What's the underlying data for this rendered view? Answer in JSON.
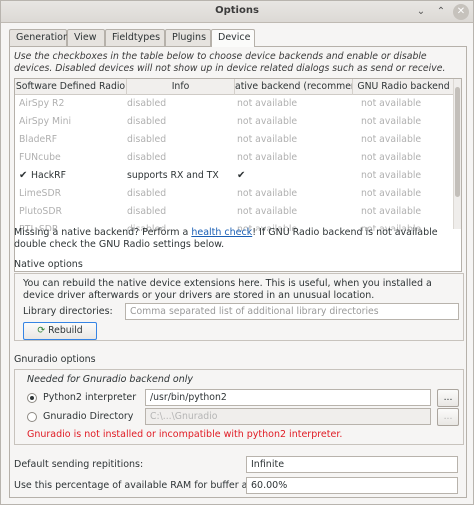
{
  "window": {
    "title": "Options",
    "minimize_glyph": "⌄",
    "maximize_glyph": "⌃",
    "close_glyph": "✕"
  },
  "tabs": [
    {
      "label": "Generation"
    },
    {
      "label": "View"
    },
    {
      "label": "Fieldtypes"
    },
    {
      "label": "Plugins"
    },
    {
      "label": "Device",
      "active": true
    }
  ],
  "device": {
    "intro": "Use the checkboxes in the table below to choose device backends and enable or disable devices. Disabled devices will not show up in device related dialogs such as send or receive.",
    "table": {
      "headers": [
        "Software Defined Radio",
        "Info",
        "ative backend (recommende",
        "GNU Radio backend"
      ],
      "rows": [
        {
          "name": "AirSpy R2",
          "info": "disabled",
          "native": "not available",
          "gnuradio": "not available",
          "enabled": false
        },
        {
          "name": "AirSpy Mini",
          "info": "disabled",
          "native": "not available",
          "gnuradio": "not available",
          "enabled": false
        },
        {
          "name": "BladeRF",
          "info": "disabled",
          "native": "not available",
          "gnuradio": "not available",
          "enabled": false
        },
        {
          "name": "FUNcube",
          "info": "disabled",
          "native": "not available",
          "gnuradio": "not available",
          "enabled": false
        },
        {
          "name": "HackRF",
          "info": "supports RX and TX",
          "native": "✔",
          "gnuradio": "not available",
          "enabled": true,
          "check": "✔"
        },
        {
          "name": "LimeSDR",
          "info": "disabled",
          "native": "not available",
          "gnuradio": "not available",
          "enabled": false
        },
        {
          "name": "PlutoSDR",
          "info": "disabled",
          "native": "not available",
          "gnuradio": "not available",
          "enabled": false
        },
        {
          "name": "RTL-SDR",
          "info": "disabled",
          "native": "not available",
          "gnuradio": "not available",
          "enabled": false
        }
      ]
    },
    "native_note_prefix": "Missing a native backend? Perform a ",
    "native_note_link": "health check",
    "native_note_suffix": "! If GNU Radio backend is not available double check the GNU Radio settings below."
  },
  "native_options": {
    "title": "Native options",
    "description": "You can rebuild the native device extensions here. This is useful, when you installed a device driver afterwards or your drivers are stored in an unusual location.",
    "library_label": "Library directories:",
    "library_placeholder": "Comma separated list of additional library directories",
    "rebuild_label": "Rebuild"
  },
  "gnuradio_options": {
    "title": "Gnuradio options",
    "needed_note": "Needed for Gnuradio backend only",
    "python2_label": "Python2 interpreter",
    "python2_value": "/usr/bin/python2",
    "gnuradio_dir_label": "Gnuradio Directory",
    "gnuradio_dir_value": "C:\\...\\Gnuradio",
    "browse_label": "...",
    "error": "Gnuradio is not installed or incompatible with python2 interpreter."
  },
  "general": {
    "repetitions_label": "Default sending repititions:",
    "repetitions_value": "Infinite",
    "ram_label": "Use this percentage of available RAM for buffer allocation:",
    "ram_value": "60.00%"
  }
}
